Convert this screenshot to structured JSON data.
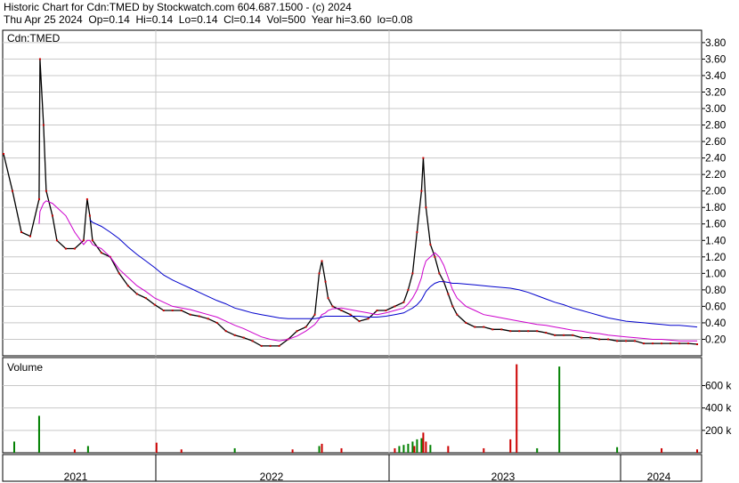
{
  "header": {
    "line1": "Historic Chart for Cdn:TMED by Stockwatch.com 604.687.1500 - (c) 2024",
    "line2": "Thu Apr 25 2024  Op=0.14  Hi=0.14  Lo=0.14  Cl=0.14  Vol=500  Year hi=3.60  lo=0.08"
  },
  "chart_data": [
    {
      "type": "line",
      "pane": "price",
      "title": "Cdn:TMED",
      "ylabel": "",
      "ylim": [
        0,
        3.95
      ],
      "y_ticks": [
        0.2,
        0.4,
        0.6,
        0.8,
        1.0,
        1.2,
        1.4,
        1.6,
        1.8,
        2.0,
        2.2,
        2.4,
        2.6,
        2.8,
        3.0,
        3.2,
        3.4,
        3.6,
        3.8
      ],
      "y_tick_labels": [
        "0.20",
        "0.40",
        "0.60",
        "0.80",
        "1.00",
        "1.20",
        "1.40",
        "1.60",
        "1.80",
        "2.00",
        "2.20",
        "2.40",
        "2.60",
        "2.80",
        "3.00",
        "3.20",
        "3.40",
        "3.60",
        "3.80"
      ],
      "x_labels": [
        "2021",
        "2022",
        "2023",
        "2024"
      ],
      "grid": true,
      "x": [
        0,
        10,
        20,
        30,
        40,
        41,
        45,
        48,
        55,
        60,
        70,
        80,
        90,
        94,
        97,
        100,
        110,
        120,
        130,
        140,
        150,
        160,
        170,
        180,
        190,
        200,
        210,
        220,
        230,
        240,
        250,
        260,
        270,
        280,
        290,
        300,
        310,
        320,
        330,
        340,
        350,
        355,
        358,
        362,
        365,
        370,
        380,
        390,
        400,
        410,
        420,
        430,
        440,
        450,
        455,
        460,
        465,
        470,
        472,
        475,
        480,
        485,
        490,
        495,
        500,
        505,
        510,
        520,
        530,
        540,
        550,
        560,
        570,
        580,
        590,
        600,
        610,
        620,
        630,
        640,
        650,
        660,
        670,
        680,
        690,
        700,
        710,
        720,
        730,
        740,
        750,
        760,
        770,
        780
      ],
      "series": [
        {
          "name": "",
          "color": "#000000",
          "style": "price",
          "values": [
            2.45,
            2.0,
            1.5,
            1.45,
            1.9,
            3.6,
            2.8,
            2.0,
            1.7,
            1.4,
            1.3,
            1.3,
            1.4,
            1.9,
            1.7,
            1.4,
            1.25,
            1.2,
            1.0,
            0.85,
            0.75,
            0.7,
            0.62,
            0.55,
            0.55,
            0.55,
            0.5,
            0.48,
            0.45,
            0.4,
            0.3,
            0.25,
            0.22,
            0.18,
            0.12,
            0.12,
            0.12,
            0.2,
            0.3,
            0.35,
            0.5,
            1.0,
            1.15,
            0.9,
            0.7,
            0.6,
            0.55,
            0.5,
            0.42,
            0.45,
            0.55,
            0.55,
            0.6,
            0.65,
            0.8,
            1.0,
            1.5,
            2.0,
            2.4,
            1.8,
            1.35,
            1.2,
            1.0,
            0.9,
            0.75,
            0.6,
            0.5,
            0.4,
            0.35,
            0.35,
            0.32,
            0.32,
            0.3,
            0.3,
            0.3,
            0.3,
            0.28,
            0.25,
            0.25,
            0.25,
            0.22,
            0.22,
            0.2,
            0.2,
            0.18,
            0.18,
            0.18,
            0.15,
            0.15,
            0.15,
            0.15,
            0.15,
            0.15,
            0.14
          ]
        },
        {
          "name": "",
          "color": "#cc00cc",
          "style": "ma-short",
          "values": [
            null,
            null,
            null,
            null,
            1.6,
            1.75,
            1.85,
            1.88,
            1.85,
            1.8,
            1.7,
            1.5,
            1.35,
            1.4,
            1.4,
            1.35,
            1.3,
            1.2,
            1.05,
            0.95,
            0.85,
            0.78,
            0.7,
            0.65,
            0.6,
            0.58,
            0.56,
            0.53,
            0.5,
            0.47,
            0.42,
            0.37,
            0.33,
            0.28,
            0.23,
            0.2,
            0.18,
            0.2,
            0.24,
            0.3,
            0.38,
            0.45,
            0.5,
            0.52,
            0.55,
            0.57,
            0.58,
            0.56,
            0.54,
            0.52,
            0.5,
            0.52,
            0.55,
            0.58,
            0.63,
            0.7,
            0.8,
            0.95,
            1.05,
            1.15,
            1.2,
            1.25,
            1.2,
            1.1,
            0.95,
            0.8,
            0.7,
            0.6,
            0.55,
            0.5,
            0.48,
            0.46,
            0.44,
            0.42,
            0.4,
            0.38,
            0.37,
            0.35,
            0.33,
            0.31,
            0.3,
            0.28,
            0.27,
            0.25,
            0.24,
            0.23,
            0.22,
            0.21,
            0.2,
            0.2,
            0.19,
            0.18,
            0.18,
            0.18
          ]
        },
        {
          "name": "",
          "color": "#0000cc",
          "style": "ma-long",
          "values": [
            null,
            null,
            null,
            null,
            null,
            null,
            null,
            null,
            null,
            null,
            null,
            null,
            null,
            null,
            1.65,
            1.62,
            1.57,
            1.5,
            1.42,
            1.32,
            1.23,
            1.15,
            1.07,
            0.98,
            0.92,
            0.87,
            0.82,
            0.77,
            0.72,
            0.67,
            0.63,
            0.58,
            0.55,
            0.52,
            0.5,
            0.48,
            0.46,
            0.45,
            0.45,
            0.45,
            0.45,
            0.46,
            0.47,
            0.48,
            0.48,
            0.48,
            0.48,
            0.48,
            0.48,
            0.47,
            0.47,
            0.48,
            0.5,
            0.52,
            0.55,
            0.58,
            0.62,
            0.68,
            0.72,
            0.78,
            0.84,
            0.88,
            0.9,
            0.9,
            0.89,
            0.88,
            0.88,
            0.87,
            0.86,
            0.85,
            0.84,
            0.83,
            0.82,
            0.8,
            0.77,
            0.73,
            0.69,
            0.65,
            0.62,
            0.58,
            0.55,
            0.52,
            0.49,
            0.46,
            0.44,
            0.42,
            0.41,
            0.4,
            0.39,
            0.38,
            0.37,
            0.37,
            0.36,
            0.35
          ]
        }
      ]
    },
    {
      "type": "bar",
      "pane": "volume",
      "title": "Volume",
      "ylim": [
        0,
        850
      ],
      "y_ticks": [
        200,
        400,
        600
      ],
      "y_tick_labels": [
        "200 k",
        "400 k",
        "600 k"
      ],
      "grid": true,
      "x": [
        12,
        40,
        80,
        95,
        172,
        200,
        260,
        325,
        355,
        358,
        380,
        440,
        445,
        450,
        455,
        460,
        462,
        465,
        470,
        472,
        475,
        480,
        500,
        540,
        570,
        577,
        600,
        625,
        690,
        740,
        780
      ],
      "values": [
        100,
        330,
        30,
        60,
        90,
        30,
        40,
        30,
        60,
        80,
        40,
        40,
        60,
        70,
        80,
        100,
        60,
        120,
        130,
        180,
        100,
        70,
        60,
        40,
        120,
        790,
        40,
        770,
        50,
        40,
        30
      ],
      "colors": [
        "#008000",
        "#008000",
        "#cc0000",
        "#008000",
        "#cc0000",
        "#cc0000",
        "#008000",
        "#cc0000",
        "#008000",
        "#cc0000",
        "#cc0000",
        "#cc0000",
        "#008000",
        "#008000",
        "#008000",
        "#008000",
        "#cc0000",
        "#008000",
        "#008000",
        "#cc0000",
        "#cc0000",
        "#008000",
        "#cc0000",
        "#cc0000",
        "#cc0000",
        "#cc0000",
        "#008000",
        "#008000",
        "#008000",
        "#cc0000",
        "#cc0000"
      ]
    }
  ]
}
